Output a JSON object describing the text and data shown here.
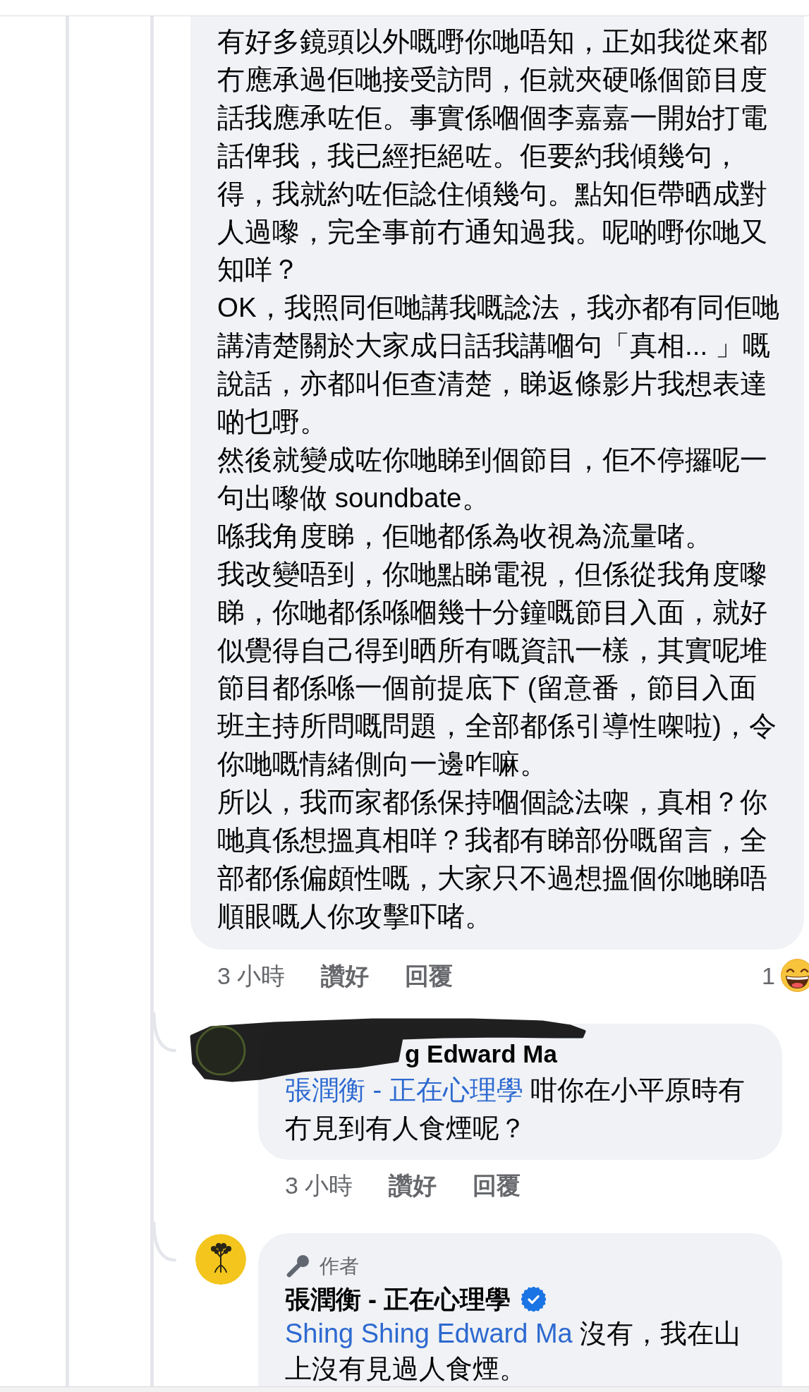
{
  "comment": {
    "paragraphs": [
      "有好多鏡頭以外嘅嘢你哋唔知，正如我從來都冇應承過佢哋接受訪問，佢就夾硬喺個節目度話我應承咗佢。事實係嗰個李嘉嘉一開始打電話俾我，我已經拒絕咗。佢要約我傾幾句，得，我就約咗佢諗住傾幾句。點知佢帶晒成對人過嚟，完全事前冇通知過我。呢啲嘢你哋又知咩？",
      "OK，我照同佢哋講我嘅諗法，我亦都有同佢哋講清楚關於大家成日話我講嗰句「真相... 」嘅說話，亦都叫佢查清楚，睇返條影片我想表達啲乜嘢。",
      "然後就變成咗你哋睇到個節目，佢不停攞呢一句出嚟做 soundbate。",
      "喺我角度睇，佢哋都係為收視為流量啫。",
      "我改變唔到，你哋點睇電視，但係從我角度嚟睇，你哋都係喺嗰幾十分鐘嘅節目入面，就好似覺得自己得到晒所有嘅資訊一樣，其實呢堆節目都係喺一個前提底下 (留意番，節目入面班主持所問嘅問題，全部都係引導性㗎啦)，令你哋嘅情緒側向一邊咋嘛。",
      "所以，我而家都係保持嗰個諗法㗎，真相？你哋真係想搵真相咩？我都有睇部份嘅留言，全部都係偏頗性嘅，大家只不過想搵個你哋睇唔順眼嘅人你攻擊吓啫。"
    ],
    "actions": {
      "time": "3 小時",
      "like": "讚好",
      "reply": "回覆"
    },
    "reaction_count": "1"
  },
  "replies": [
    {
      "kind": "redacted",
      "author": "g Edward Ma",
      "mention": "張潤衡 - 正在心理學",
      "text": "咁你在小平原時有冇見到有人食煙呢？",
      "actions": {
        "time": "3 小時",
        "like": "讚好",
        "reply": "回覆"
      }
    },
    {
      "kind": "author",
      "badge": "作者",
      "author": "張潤衡 - 正在心理學",
      "verified": true,
      "mention": "Shing Shing Edward Ma",
      "text": "沒有，我在山上沒有見過人食煙。"
    }
  ]
}
